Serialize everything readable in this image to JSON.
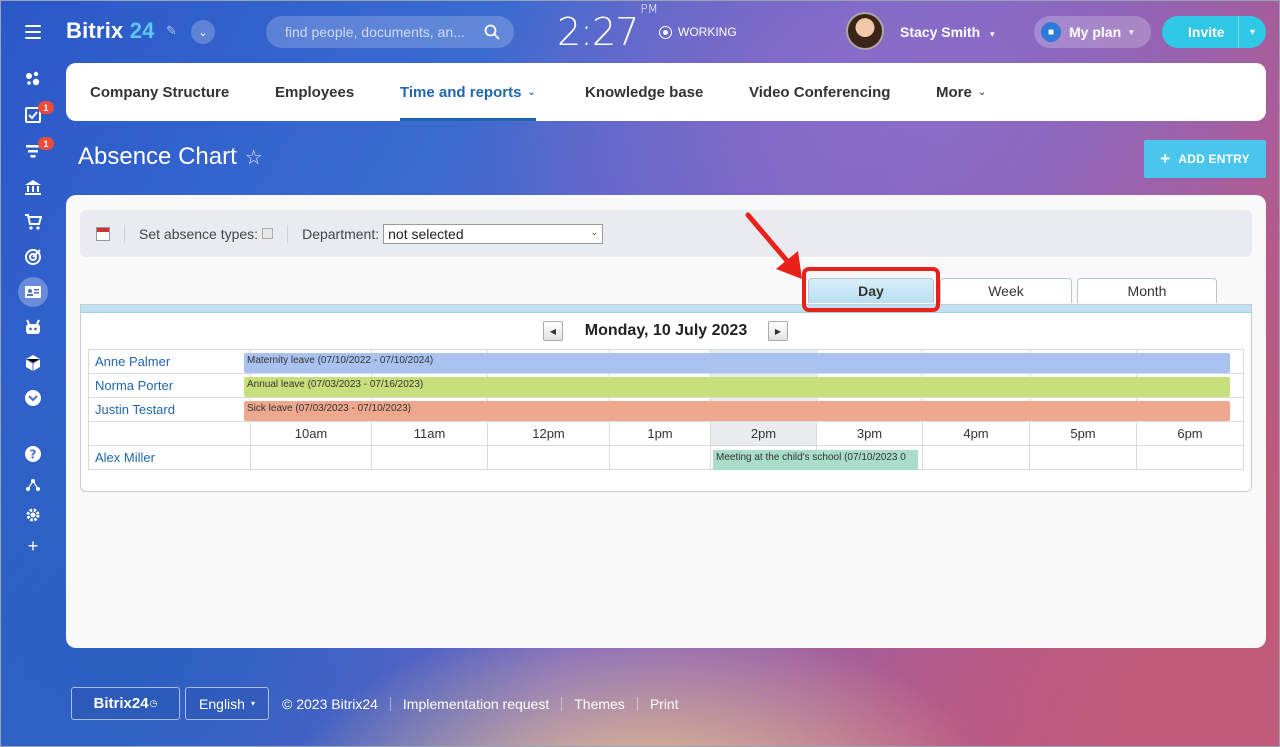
{
  "header": {
    "logo_main": "Bitrix",
    "logo_num": "24",
    "search_placeholder": "find people, documents, an...",
    "clock_time": "2:27",
    "clock_ampm": "PM",
    "status": "WORKING",
    "user_name": "Stacy Smith",
    "plan_label": "My plan",
    "invite_label": "Invite"
  },
  "sidebar": {
    "badges": [
      "1",
      "1"
    ]
  },
  "nav": {
    "tabs": [
      {
        "label": "Company Structure"
      },
      {
        "label": "Employees"
      },
      {
        "label": "Time and reports"
      },
      {
        "label": "Knowledge base"
      },
      {
        "label": "Video Conferencing"
      },
      {
        "label": "More"
      }
    ],
    "active": "Time and reports"
  },
  "page": {
    "title": "Absence Chart",
    "add_entry": "ADD ENTRY"
  },
  "filters": {
    "absence_types_label": "Set absence types:",
    "department_label": "Department:",
    "department_value": "not selected"
  },
  "view_tabs": [
    "Day",
    "Week",
    "Month"
  ],
  "active_view": "Day",
  "chart": {
    "date": "Monday, 10 July 2023",
    "hours": [
      "10am",
      "11am",
      "12pm",
      "1pm",
      "2pm",
      "3pm",
      "4pm",
      "5pm",
      "6pm"
    ],
    "highlight_hour": "2pm",
    "employees": [
      "Anne Palmer",
      "Norma Porter",
      "Justin Testard",
      "Alex Miller"
    ],
    "absences": [
      {
        "employee": "Anne Palmer",
        "label": "Maternity leave (07/10/2022 - 07/10/2024)",
        "color": "#a9c2f0"
      },
      {
        "employee": "Norma Porter",
        "label": "Annual leave (07/03/2023 - 07/16/2023)",
        "color": "#c8e07c"
      },
      {
        "employee": "Justin Testard",
        "label": "Sick leave (07/03/2023 - 07/10/2023)",
        "color": "#eea88e"
      },
      {
        "employee": "Alex Miller",
        "label": "Meeting at the child's school (07/10/2023 0",
        "color": "#a9dcc9"
      }
    ]
  },
  "footer": {
    "logo": "Bitrix24",
    "language": "English",
    "copyright": "© 2023 Bitrix24",
    "links": [
      "Implementation request",
      "Themes",
      "Print"
    ]
  }
}
